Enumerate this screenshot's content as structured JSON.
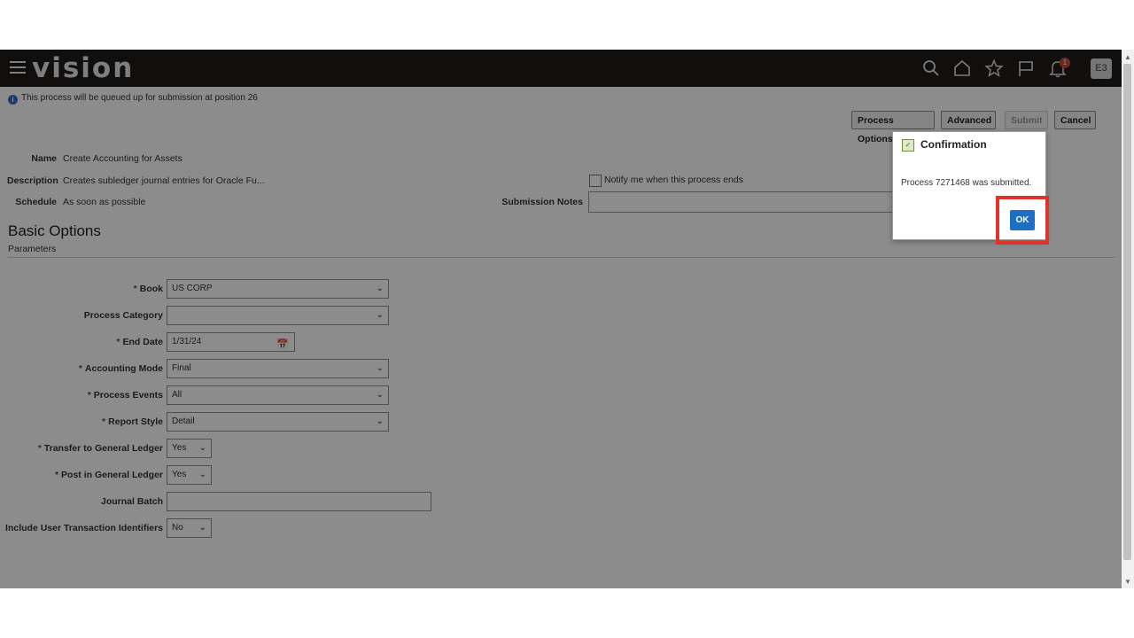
{
  "header": {
    "logo_text": "vision",
    "icons": [
      "search-icon",
      "home-icon",
      "star-icon",
      "flag-icon",
      "bell-icon"
    ],
    "notification_count": "1",
    "avatar_initials": "E3"
  },
  "info_message": "This process will be queued up for submission at position 26",
  "toolbar": {
    "process_options": "Process Options",
    "advanced": "Advanced",
    "submit": "Submit",
    "cancel": "Cancel"
  },
  "details": {
    "name_label": "Name",
    "name_value": "Create Accounting for Assets",
    "description_label": "Description",
    "description_value": "Creates subledger journal entries for Oracle Fu...",
    "schedule_label": "Schedule",
    "schedule_value": "As soon as possible",
    "notify_label": "Notify me when this process ends",
    "submission_notes_label": "Submission Notes"
  },
  "section": {
    "title": "Basic Options",
    "subtitle": "Parameters"
  },
  "params": {
    "book": {
      "label": "Book",
      "value": "US CORP"
    },
    "process_category": {
      "label": "Process Category",
      "value": ""
    },
    "end_date": {
      "label": "End Date",
      "value": "1/31/24"
    },
    "accounting_mode": {
      "label": "Accounting Mode",
      "value": "Final"
    },
    "process_events": {
      "label": "Process Events",
      "value": "All"
    },
    "report_style": {
      "label": "Report Style",
      "value": "Detail"
    },
    "transfer_gl": {
      "label": "Transfer to General Ledger",
      "value": "Yes"
    },
    "post_gl": {
      "label": "Post in General Ledger",
      "value": "Yes"
    },
    "journal_batch": {
      "label": "Journal Batch",
      "value": ""
    },
    "include_user_tx": {
      "label": "Include User Transaction Identifiers",
      "value": "No"
    }
  },
  "required_marker": "*",
  "dialog": {
    "title": "Confirmation",
    "message": "Process 7271468 was submitted.",
    "ok_label": "OK"
  },
  "colors": {
    "header_bg": "#1f1c1b",
    "ok_button": "#1b6fc4",
    "highlight": "#e0342a",
    "required_star": "#1a5fa8"
  }
}
